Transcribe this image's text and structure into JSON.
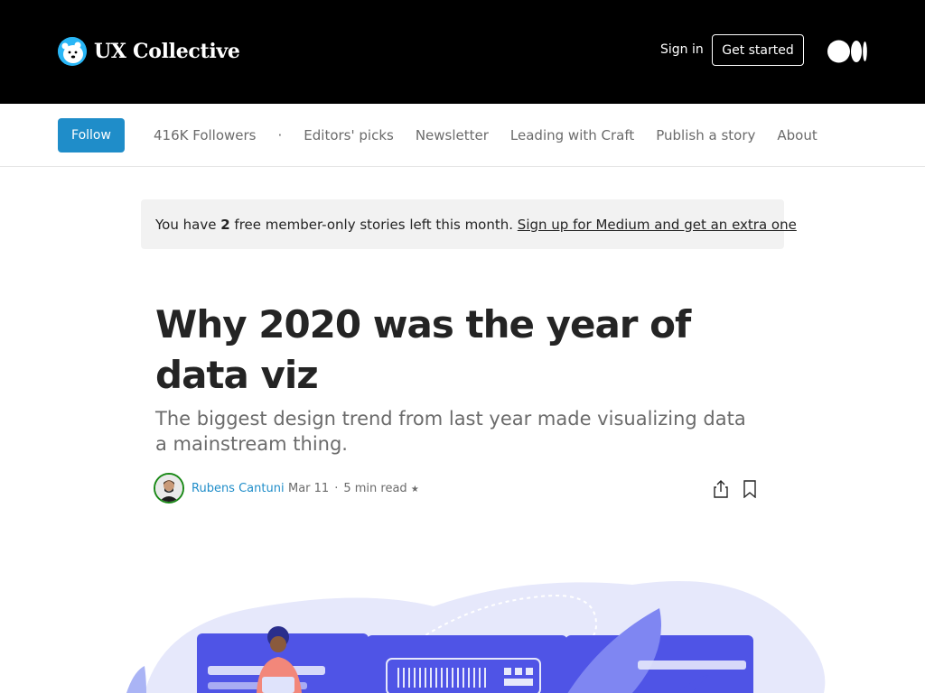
{
  "header": {
    "brand_name": "UX Collective",
    "signin_label": "Sign in",
    "get_started_label": "Get started",
    "brand_logo_icon": "polar-bear-icon",
    "medium_logo_icon": "medium-logo-icon"
  },
  "publication_nav": {
    "follow_label": "Follow",
    "followers": "416K Followers",
    "separator": "·",
    "links": [
      "Editors' picks",
      "Newsletter",
      "Leading with Craft",
      "Publish a story",
      "About"
    ]
  },
  "banner": {
    "prefix": "You have ",
    "count": "2",
    "suffix": " free member-only stories left this month. ",
    "link": "Sign up for Medium and get an extra one"
  },
  "article": {
    "title": "Why 2020 was the year of data viz",
    "subtitle": "The biggest design trend from last year made visualizing data a mainstream thing.",
    "author": "Rubens Cantuni",
    "date": "Mar 11",
    "separator": "·",
    "read_time": "5 min read",
    "member_star": "★",
    "share_icon": "share-icon",
    "bookmark_icon": "bookmark-icon"
  },
  "colors": {
    "top_bar": "#000000",
    "follow_button": "#1f8dc9",
    "author_link": "#1f8dc9",
    "avatar_ring": "#1a8917",
    "banner_bg": "#f2f2f2",
    "hero_accent": "#5b5fe8"
  }
}
